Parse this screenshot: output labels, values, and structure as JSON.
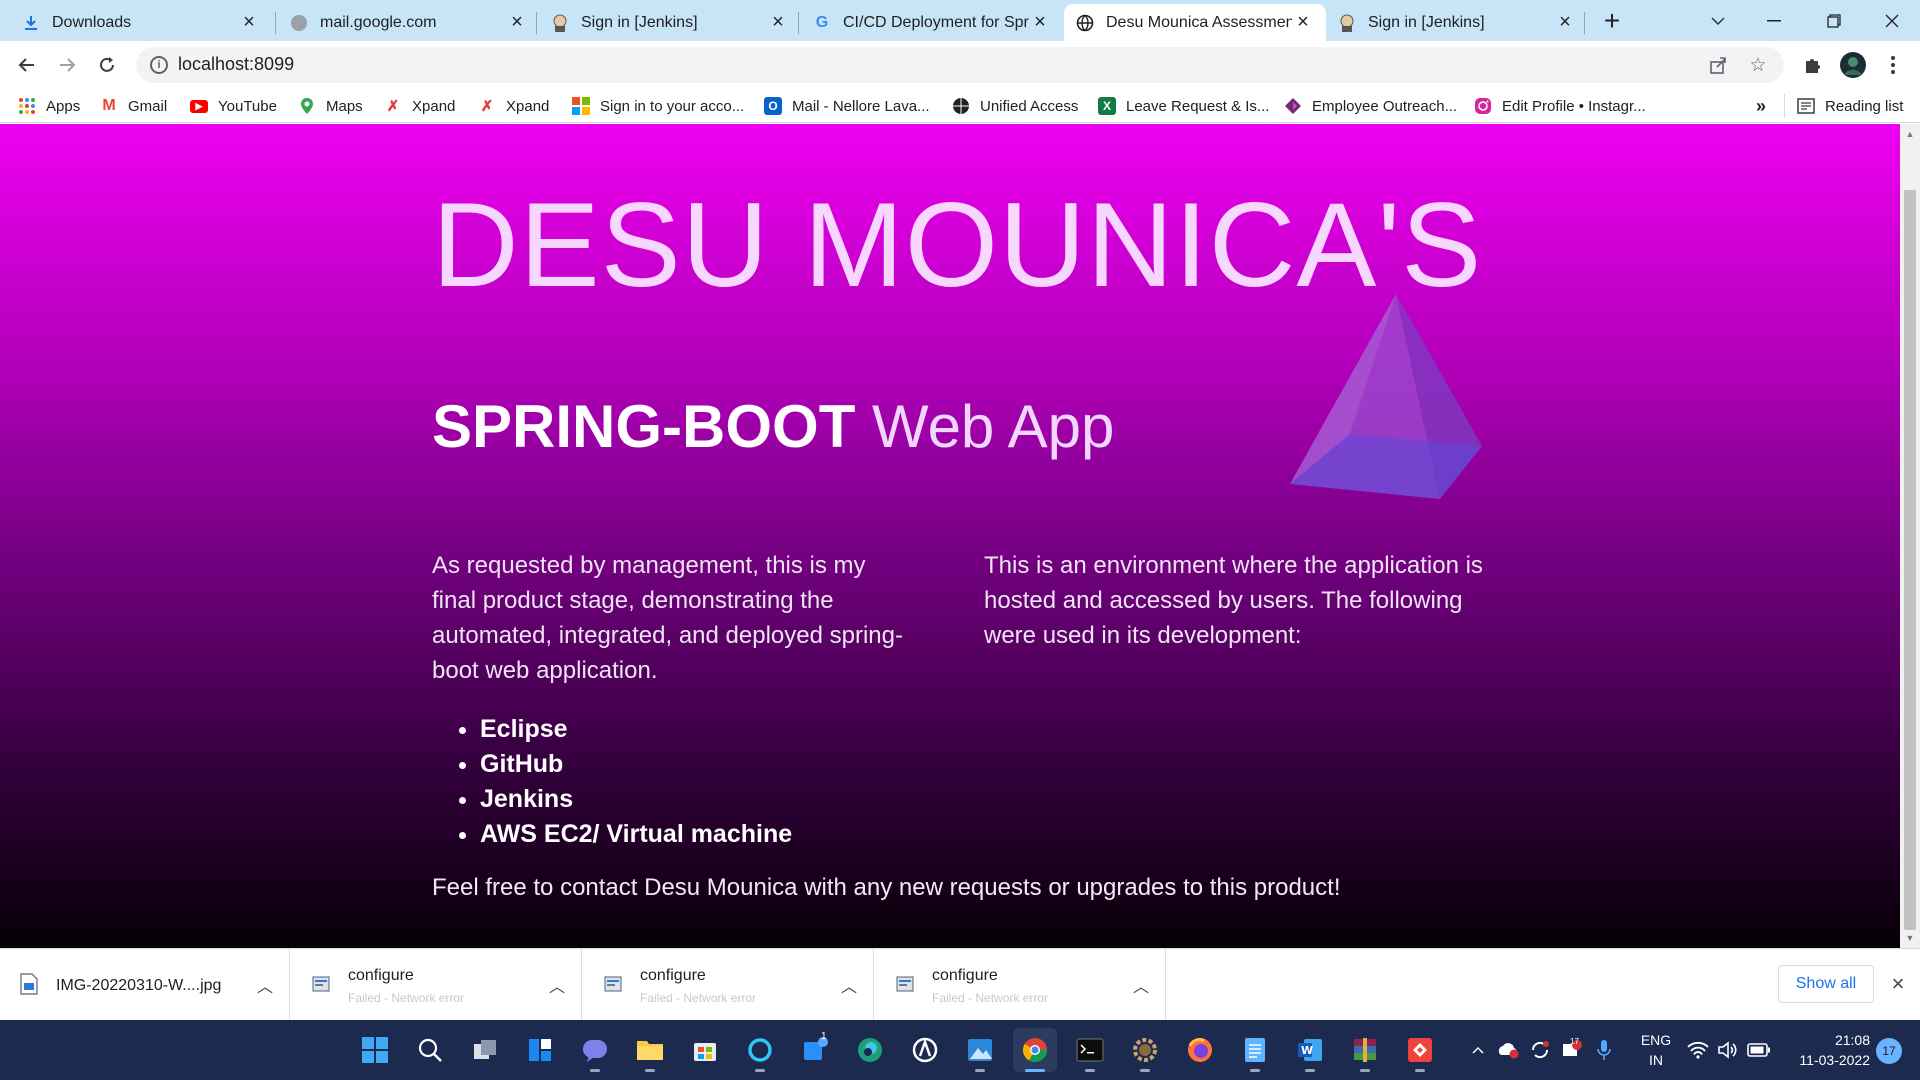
{
  "tabs": [
    {
      "title": "Downloads",
      "icon": "download-icon"
    },
    {
      "title": "mail.google.com",
      "icon": "globe-icon"
    },
    {
      "title": "Sign in [Jenkins]",
      "icon": "jenkins-icon"
    },
    {
      "title": "CI/CD Deployment for Sprir",
      "icon": "google-icon"
    },
    {
      "title": "Desu Mounica Assessment",
      "icon": "globe-icon",
      "active": true
    },
    {
      "title": "Sign in [Jenkins]",
      "icon": "jenkins-icon"
    }
  ],
  "omnibox": {
    "url": "localhost:8099"
  },
  "bookmarks": [
    {
      "label": "Apps",
      "icon": "apps-grid-icon"
    },
    {
      "label": "Gmail",
      "icon": "gmail-icon"
    },
    {
      "label": "YouTube",
      "icon": "youtube-icon"
    },
    {
      "label": "Maps",
      "icon": "maps-icon"
    },
    {
      "label": "Xpand",
      "icon": "xpand-icon"
    },
    {
      "label": "Xpand",
      "icon": "xpand-icon"
    },
    {
      "label": "Sign in to your acco...",
      "icon": "microsoft-icon"
    },
    {
      "label": "Mail - Nellore Lava...",
      "icon": "outlook-icon"
    },
    {
      "label": "Unified Access",
      "icon": "globe-icon"
    },
    {
      "label": "Leave Request & Is...",
      "icon": "excel-icon"
    },
    {
      "label": "Employee Outreach...",
      "icon": "powerapps-icon"
    },
    {
      "label": "Edit Profile • Instagr...",
      "icon": "instagram-icon"
    }
  ],
  "bookmarks_overflow": "»",
  "reading_list": "Reading list",
  "page": {
    "heading": "DESU MOUNICA'S",
    "subheading_bold": "SPRING-BOOT",
    "subheading_light": "Web App",
    "left_paragraph": "As requested by management, this is my final product stage, demonstrating the automated, integrated, and deployed spring-boot web application.",
    "right_paragraph": "This is an environment where the application is hosted and accessed by users. The following were used in its development:",
    "tools": [
      "Eclipse",
      "GitHub",
      "Jenkins",
      "AWS EC2/ Virtual machine"
    ],
    "footer": "Feel free to contact Desu Mounica with any new requests or upgrades to this product!"
  },
  "downloads": [
    {
      "name": "IMG-20220310-W....jpg",
      "status": ""
    },
    {
      "name": "configure",
      "status": "Failed - Network error"
    },
    {
      "name": "configure",
      "status": "Failed - Network error"
    },
    {
      "name": "configure",
      "status": "Failed - Network error"
    }
  ],
  "downloads_show_all": "Show all",
  "taskbar": {
    "language_line1": "ENG",
    "language_line2": "IN",
    "time": "21:08",
    "date": "11-03-2022",
    "notification_count": "17",
    "video_badge": "1",
    "tray_badge": "17"
  },
  "colors": {
    "tab_strip": "#c8e5f7",
    "page_gradient_top": "#ee00f0",
    "page_gradient_bottom": "#060006",
    "taskbar": "#1b2a4e",
    "link_blue": "#1a73e8"
  }
}
